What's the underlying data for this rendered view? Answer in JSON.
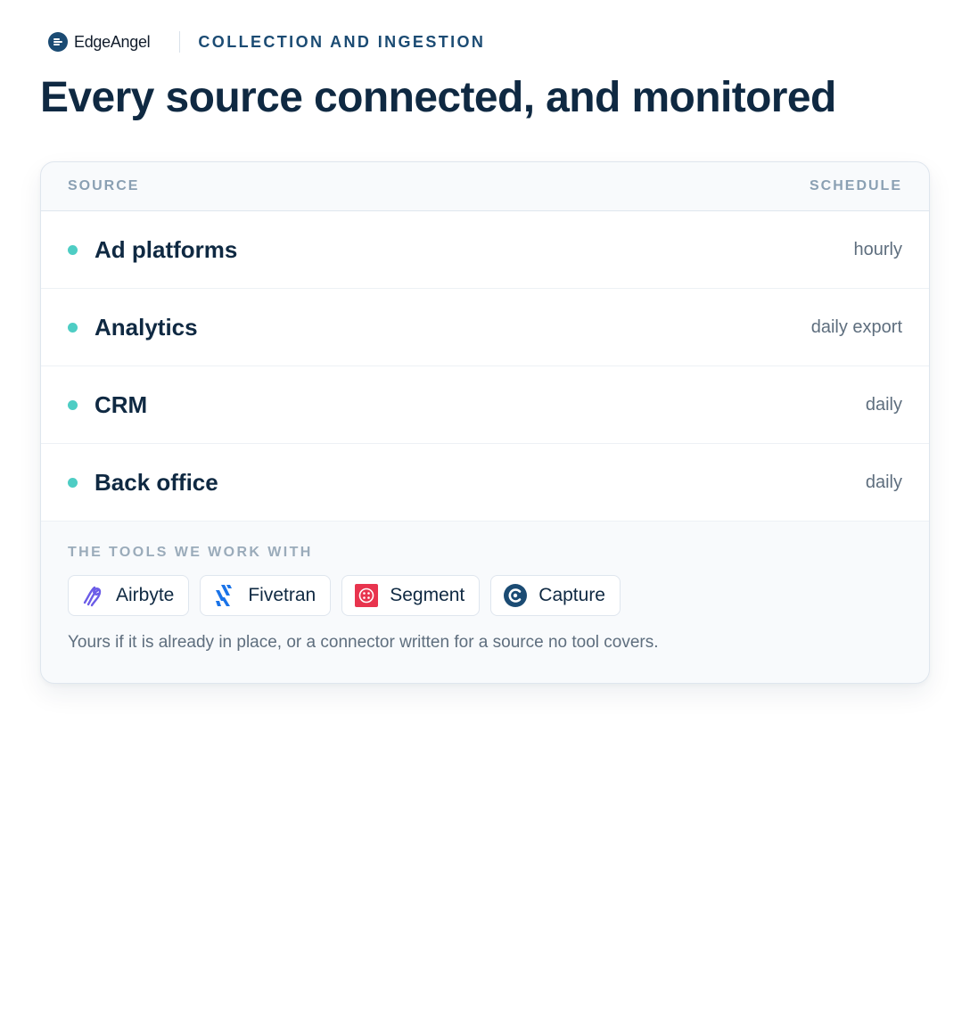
{
  "header": {
    "brand_name": "EdgeAngel",
    "brand_icon": "edgeangel-logo-icon",
    "section_label": "COLLECTION AND INGESTION"
  },
  "title": "Every source connected, and monitored",
  "table": {
    "columns": [
      "SOURCE",
      "SCHEDULE"
    ],
    "rows": [
      {
        "source": "Ad platforms",
        "schedule": "hourly",
        "status_color": "#4ecdc4"
      },
      {
        "source": "Analytics",
        "schedule": "daily export",
        "status_color": "#4ecdc4"
      },
      {
        "source": "CRM",
        "schedule": "daily",
        "status_color": "#4ecdc4"
      },
      {
        "source": "Back office",
        "schedule": "daily",
        "status_color": "#4ecdc4"
      }
    ]
  },
  "tools": {
    "label": "THE TOOLS WE WORK WITH",
    "items": [
      {
        "label": "Airbyte",
        "icon": "airbyte-icon",
        "color": "#6b5ce7"
      },
      {
        "label": "Fivetran",
        "icon": "fivetran-icon",
        "color": "#1a73e8"
      },
      {
        "label": "Segment",
        "icon": "segment-icon",
        "color": "#e8344e"
      },
      {
        "label": "Capture",
        "icon": "capture-icon",
        "color": "#1b4b73"
      }
    ],
    "note": "Yours if it is already in place, or a connector written for a source no tool covers."
  },
  "colors": {
    "accent": "#1b4b73",
    "heading": "#0f2942",
    "status_dot": "#4ecdc4"
  }
}
